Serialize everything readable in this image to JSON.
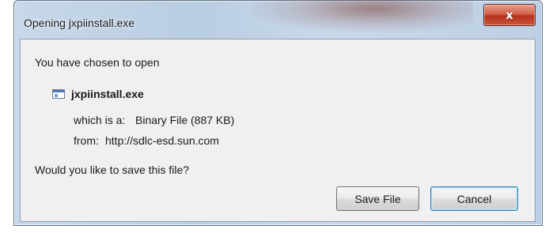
{
  "window": {
    "title": "Opening jxpiinstall.exe",
    "close_glyph": "x"
  },
  "dialog": {
    "intro": "You have chosen to open",
    "file_icon": "executable-file-icon",
    "file_name": "jxpiinstall.exe",
    "type_label": "which is a:",
    "type_value": "Binary File (887 KB)",
    "from_label": "from:",
    "from_value": "http://sdlc-esd.sun.com",
    "question": "Would you like to save this file?"
  },
  "buttons": {
    "save_label": "Save File",
    "cancel_label": "Cancel"
  },
  "colors": {
    "frame": "#c7d8ea",
    "client": "#f0f0f0",
    "close_button": "#c9553b",
    "default_button_border": "#3c7fb1"
  }
}
